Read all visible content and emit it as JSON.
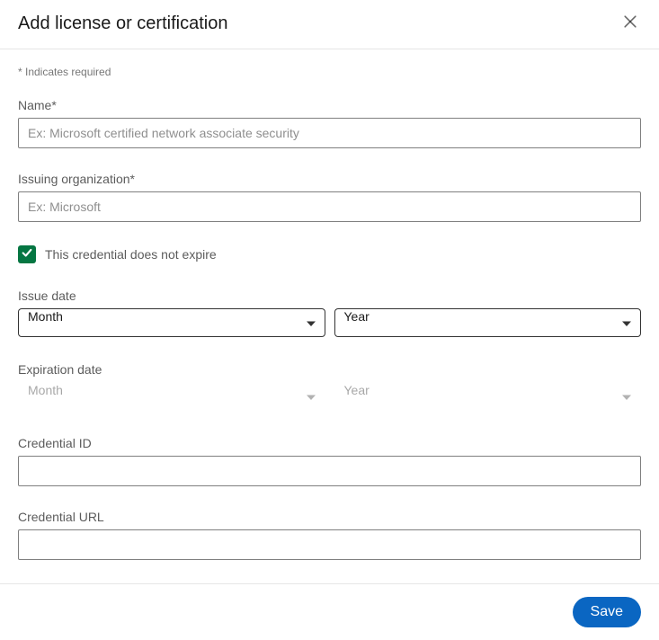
{
  "header": {
    "title": "Add license or certification"
  },
  "required_note": "* Indicates required",
  "fields": {
    "name": {
      "label": "Name*",
      "placeholder": "Ex: Microsoft certified network associate security",
      "value": ""
    },
    "org": {
      "label": "Issuing organization*",
      "placeholder": "Ex: Microsoft",
      "value": ""
    },
    "no_expire": {
      "label": "This credential does not expire",
      "checked": true
    },
    "issue_date": {
      "label": "Issue date",
      "month": "Month",
      "year": "Year"
    },
    "exp_date": {
      "label": "Expiration date",
      "month": "Month",
      "year": "Year",
      "disabled": true
    },
    "cred_id": {
      "label": "Credential ID",
      "value": ""
    },
    "cred_url": {
      "label": "Credential URL",
      "value": ""
    }
  },
  "footer": {
    "save_label": "Save"
  }
}
